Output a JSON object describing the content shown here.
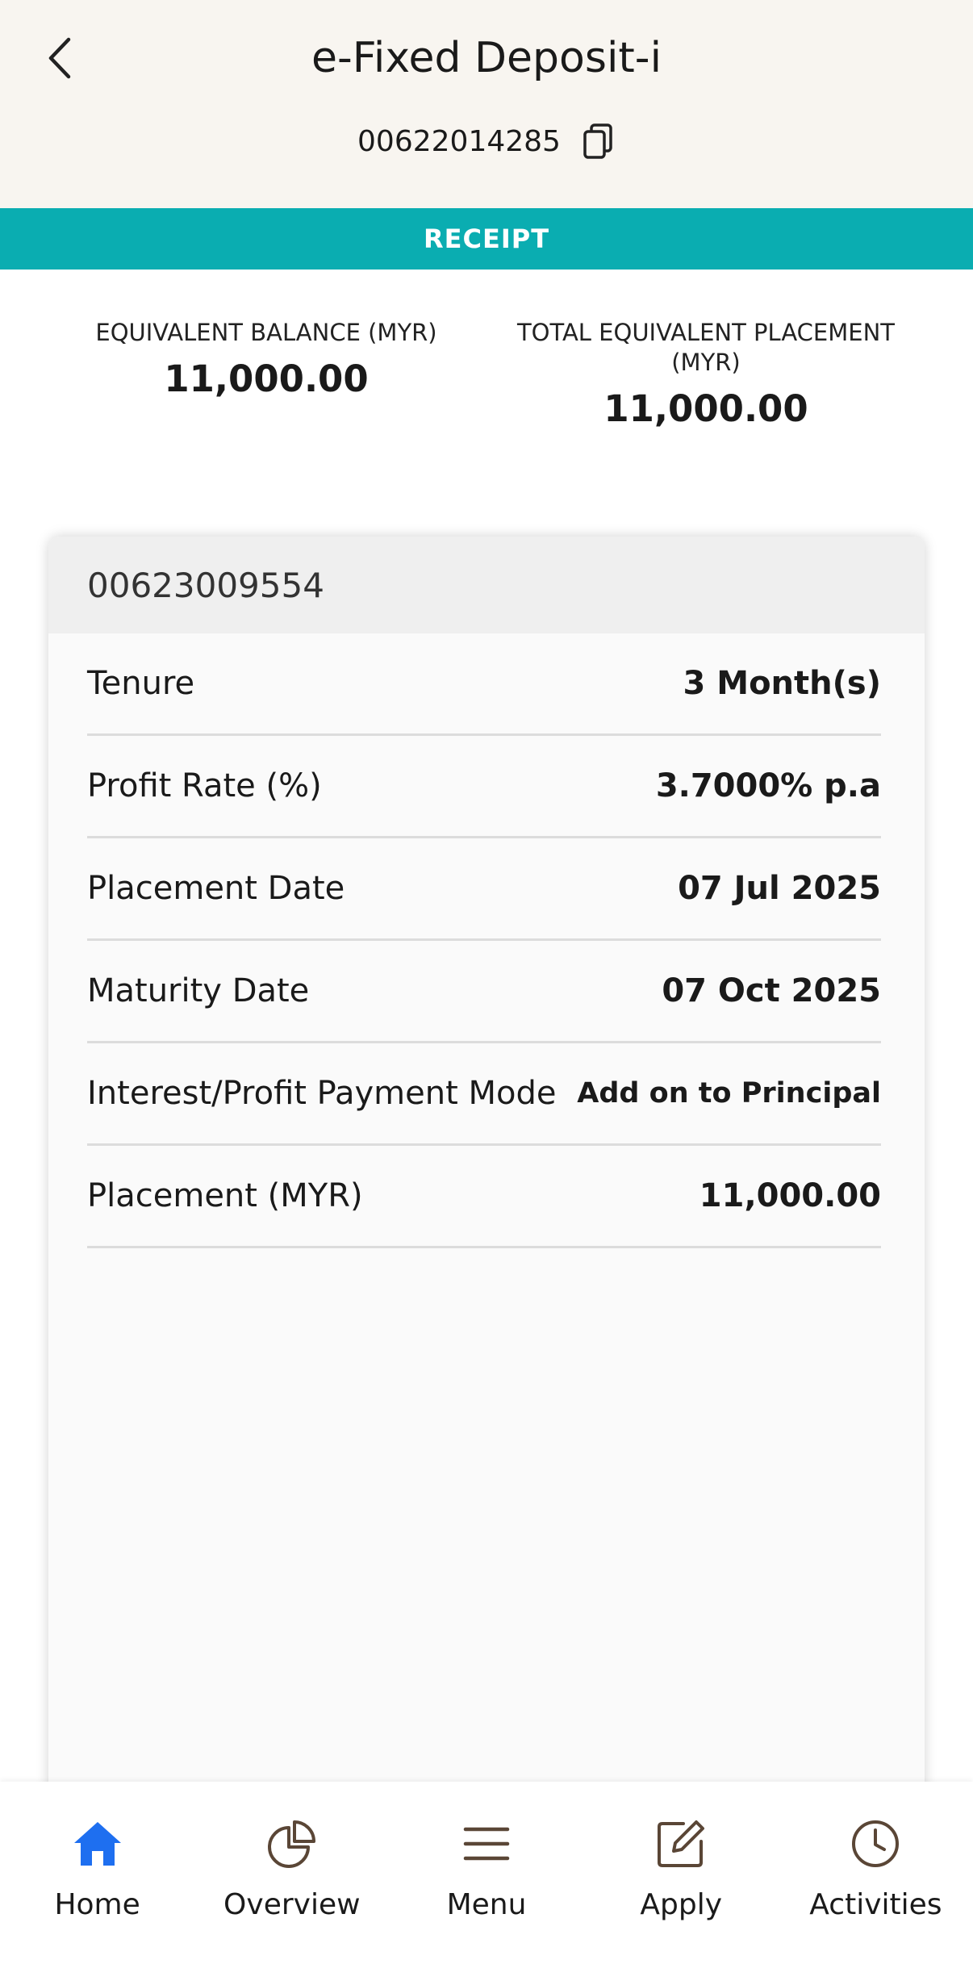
{
  "header": {
    "title": "e-Fixed Deposit-i",
    "account_number": "00622014285"
  },
  "receipt_label": "RECEIPT",
  "summary": {
    "equivalent_balance_label": "EQUIVALENT BALANCE (MYR)",
    "equivalent_balance_value": "11,000.00",
    "total_placement_label_line1": "TOTAL EQUIVALENT PLACEMENT",
    "total_placement_label_line2": "(MYR)",
    "total_placement_value": "11,000.00"
  },
  "card": {
    "certificate_number": "00623009554",
    "rows": [
      {
        "label": "Tenure",
        "value": "3 Month(s)"
      },
      {
        "label": "Profit Rate (%)",
        "value": "3.7000% p.a"
      },
      {
        "label": "Placement Date",
        "value": "07 Jul 2025"
      },
      {
        "label": "Maturity Date",
        "value": "07 Oct 2025"
      },
      {
        "label": "Interest/Profit Payment Mode",
        "value": "Add on to Principal"
      },
      {
        "label": "Placement (MYR)",
        "value": "11,000.00"
      }
    ]
  },
  "nav": {
    "items": [
      {
        "label": "Home",
        "icon": "home-icon",
        "active": true
      },
      {
        "label": "Overview",
        "icon": "pie-chart-icon",
        "active": false
      },
      {
        "label": "Menu",
        "icon": "menu-icon",
        "active": false
      },
      {
        "label": "Apply",
        "icon": "edit-icon",
        "active": false
      },
      {
        "label": "Activities",
        "icon": "clock-icon",
        "active": false
      }
    ]
  },
  "colors": {
    "header_bg": "#f8f5f0",
    "receipt_bar": "#0aadb1",
    "active_nav": "#1e6ff0",
    "icon_brown": "#5a4636"
  }
}
